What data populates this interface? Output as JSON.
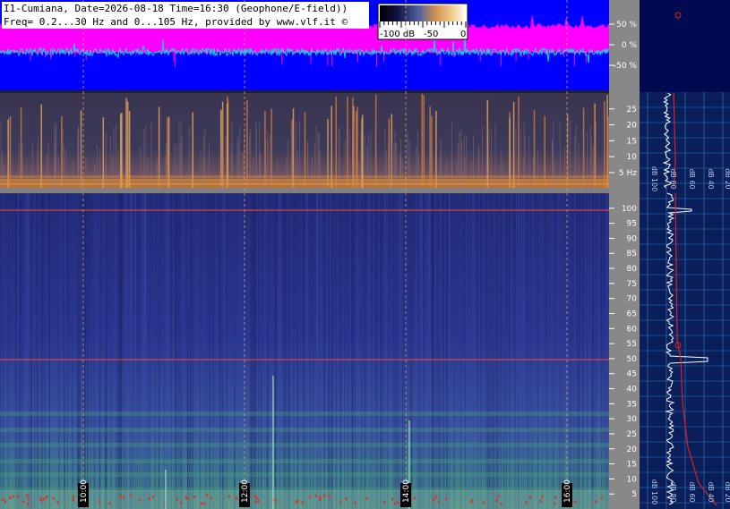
{
  "header": {
    "line1": "I1-Cumiana, Date=2026-08-18 Time=16:30 (Geophone/E-field))",
    "line2": "Freq= 0.2...30 Hz and 0...105 Hz, provided by www.vlf.it ©"
  },
  "colorbar": {
    "labels": [
      "-100 dB",
      "-50",
      "0"
    ]
  },
  "chart_data": [
    {
      "type": "line",
      "name": "waveform",
      "y_ticks": [
        "50 %",
        "0 %",
        "-50 %"
      ],
      "y_values": [
        50,
        0,
        -50
      ],
      "ylim": [
        -100,
        100
      ],
      "colors": {
        "envelope": "#ff00ff",
        "trace": "#00e0e0",
        "background": "#0000ff"
      }
    },
    {
      "type": "heatmap",
      "name": "low-frequency spectrogram",
      "y_ticks": [
        "25",
        "20",
        "15",
        "10",
        "5 Hz"
      ],
      "y_values": [
        25,
        20,
        15,
        10,
        5
      ],
      "ylim": [
        0.2,
        30
      ]
    },
    {
      "type": "heatmap",
      "name": "spectrogram",
      "y_ticks": [
        "100",
        "95",
        "90",
        "85",
        "80",
        "75",
        "70",
        "65",
        "60",
        "55",
        "50",
        "45",
        "40",
        "35",
        "30",
        "25",
        "20",
        "15",
        "10",
        "5"
      ],
      "y_values": [
        100,
        95,
        90,
        85,
        80,
        75,
        70,
        65,
        60,
        55,
        50,
        45,
        40,
        35,
        30,
        25,
        20,
        15,
        10,
        5
      ],
      "ylim": [
        0,
        105
      ],
      "x_ticks": [
        "10:00",
        "12:00",
        "14:00",
        "16:00"
      ],
      "hum_lines_hz": [
        50,
        100
      ]
    },
    {
      "type": "line",
      "name": "spectrum profile",
      "x_ticks_top": [
        "dB 100",
        "dB 80",
        "dB 60",
        "dB 40",
        "dB 20"
      ],
      "x_ticks_bottom": [
        "dB 100",
        "dB 80",
        "dB 60",
        "dB 40",
        "dB 20"
      ]
    }
  ]
}
